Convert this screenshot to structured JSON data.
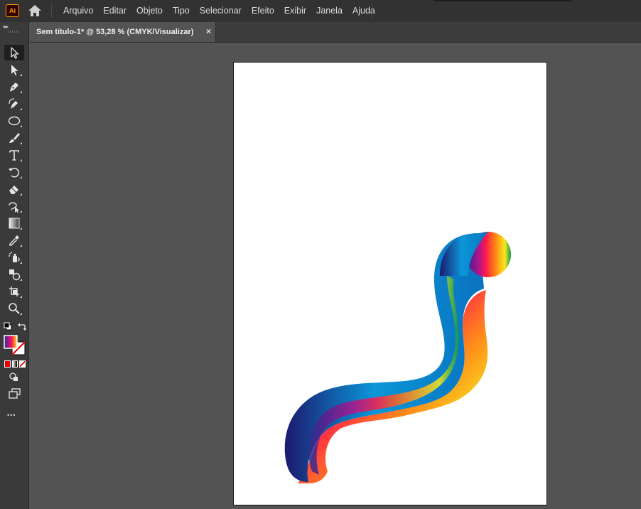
{
  "app": {
    "logo_text": "Ai",
    "menu": [
      "Arquivo",
      "Editar",
      "Objeto",
      "Tipo",
      "Selecionar",
      "Efeito",
      "Exibir",
      "Janela",
      "Ajuda"
    ]
  },
  "document_tab": {
    "title": "Sem título-1* @ 53,28 % (CMYK/Visualizar)",
    "close_glyph": "×"
  },
  "toolbar": {
    "collapse_glyph": "▸▸",
    "more_glyph": "•••",
    "tools": [
      {
        "name": "selection-tool",
        "icon": "arrow-icon",
        "active": true
      },
      {
        "name": "direct-selection-tool",
        "icon": "white-arrow-icon"
      },
      {
        "name": "pen-tool",
        "icon": "pen-icon"
      },
      {
        "name": "curvature-tool",
        "icon": "curvature-pen-icon"
      },
      {
        "name": "ellipse-tool",
        "icon": "ellipse-icon"
      },
      {
        "name": "paintbrush-tool",
        "icon": "brush-icon"
      },
      {
        "name": "type-tool",
        "icon": "type-icon"
      },
      {
        "name": "rotate-tool",
        "icon": "rotate-icon"
      },
      {
        "name": "eraser-tool",
        "icon": "eraser-icon"
      },
      {
        "name": "puppet-warp-tool",
        "icon": "puppet-warp-icon"
      },
      {
        "name": "gradient-tool",
        "icon": "gradient-icon"
      },
      {
        "name": "eyedropper-tool",
        "icon": "eyedropper-icon"
      },
      {
        "name": "symbol-sprayer-tool",
        "icon": "sprayer-icon"
      },
      {
        "name": "shape-builder-tool",
        "icon": "shape-builder-icon"
      },
      {
        "name": "artboard-tool",
        "icon": "artboard-icon"
      },
      {
        "name": "zoom-tool",
        "icon": "magnifier-icon"
      }
    ]
  },
  "colors": {
    "accent": "#ff9a00",
    "chrome_dark": "#323232",
    "canvas_bg": "#535353",
    "artboard": "#ffffff",
    "gradient": [
      "#1c1a6e",
      "#2a2f8f",
      "#3b1f87",
      "#6f1a8f",
      "#b0158c",
      "#e3107b",
      "#ff1a4d",
      "#ff6a1a",
      "#ffb21a",
      "#f7e81e",
      "#c9e01a",
      "#5bbf2a",
      "#0a9a4a"
    ]
  }
}
